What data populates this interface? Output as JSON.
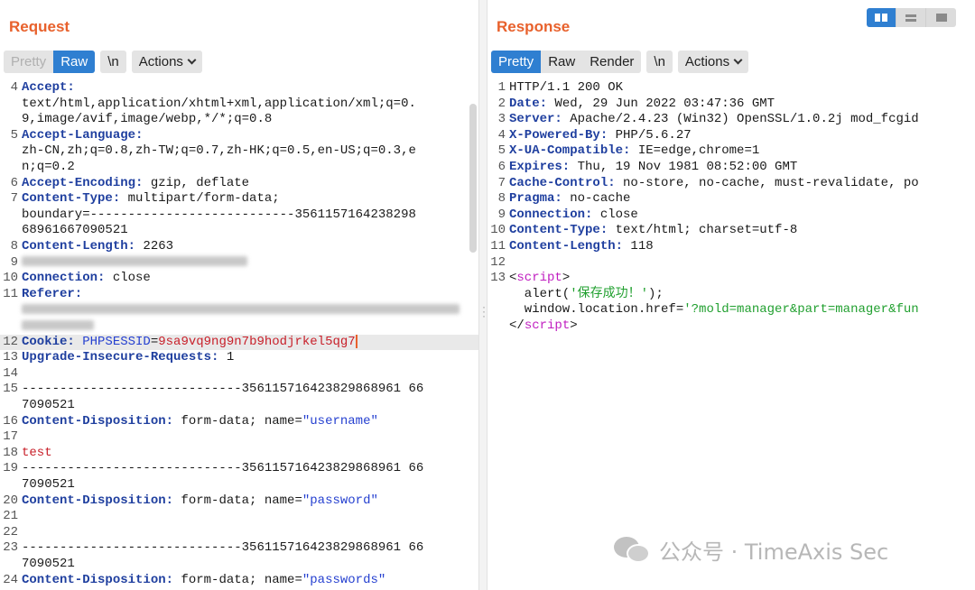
{
  "request": {
    "title": "Request",
    "tabs": [
      "Pretty",
      "Raw"
    ],
    "newline_label": "\\n",
    "actions_label": "Actions",
    "lines": [
      {
        "n": "4",
        "parts": [
          {
            "c": "hdr",
            "t": "Accept:"
          }
        ]
      },
      {
        "n": "",
        "parts": [
          {
            "t": "text/html,application/xhtml+xml,application/xml;q=0."
          }
        ]
      },
      {
        "n": "",
        "parts": [
          {
            "t": "9,image/avif,image/webp,*/*;q=0.8"
          }
        ]
      },
      {
        "n": "5",
        "parts": [
          {
            "c": "hdr",
            "t": "Accept-Language:"
          }
        ]
      },
      {
        "n": "",
        "parts": [
          {
            "t": "zh-CN,zh;q=0.8,zh-TW;q=0.7,zh-HK;q=0.5,en-US;q=0.3,e"
          }
        ]
      },
      {
        "n": "",
        "parts": [
          {
            "t": "n;q=0.2"
          }
        ]
      },
      {
        "n": "6",
        "parts": [
          {
            "c": "hdr",
            "t": "Accept-Encoding:"
          },
          {
            "t": " gzip, deflate"
          }
        ]
      },
      {
        "n": "7",
        "parts": [
          {
            "c": "hdr",
            "t": "Content-Type:"
          },
          {
            "t": " multipart/form-data;"
          }
        ]
      },
      {
        "n": "",
        "parts": [
          {
            "t": "boundary=---------------------------3561157164238298"
          }
        ]
      },
      {
        "n": "",
        "parts": [
          {
            "t": "68961667090521"
          }
        ]
      },
      {
        "n": "8",
        "parts": [
          {
            "c": "hdr",
            "t": "Content-Length:"
          },
          {
            "t": " 2263"
          }
        ]
      },
      {
        "n": "9",
        "parts": [
          {
            "c": "blur",
            "w": "250"
          }
        ]
      },
      {
        "n": "10",
        "parts": [
          {
            "c": "hdr",
            "t": "Connection:"
          },
          {
            "t": " close"
          }
        ]
      },
      {
        "n": "11",
        "parts": [
          {
            "c": "hdr",
            "t": "Referer:"
          }
        ]
      },
      {
        "n": "",
        "parts": [
          {
            "c": "blur",
            "w": "485"
          }
        ]
      },
      {
        "n": "",
        "parts": [
          {
            "c": "blur",
            "w": "80"
          }
        ]
      },
      {
        "n": "12",
        "hl": true,
        "parts": [
          {
            "c": "hdr",
            "t": "Cookie:"
          },
          {
            "t": " "
          },
          {
            "c": "str",
            "t": "PHPSESSID"
          },
          {
            "t": "="
          },
          {
            "c": "red",
            "t": "9sa9vq9ng9n7b9hodjrkel5qg7"
          },
          {
            "c": "cursor"
          }
        ]
      },
      {
        "n": "13",
        "parts": [
          {
            "c": "hdr",
            "t": "Upgrade-Insecure-Requests:"
          },
          {
            "t": " 1"
          }
        ]
      },
      {
        "n": "14",
        "parts": [
          {
            "t": ""
          }
        ]
      },
      {
        "n": "15",
        "parts": [
          {
            "t": "-----------------------------356115716423829868961 66"
          }
        ]
      },
      {
        "n": "",
        "parts": [
          {
            "t": "7090521"
          }
        ]
      },
      {
        "n": "16",
        "parts": [
          {
            "c": "hdr",
            "t": "Content-Disposition:"
          },
          {
            "t": " form-data; name="
          },
          {
            "c": "str",
            "t": "\"username\""
          }
        ]
      },
      {
        "n": "17",
        "parts": [
          {
            "t": ""
          }
        ]
      },
      {
        "n": "18",
        "parts": [
          {
            "c": "red",
            "t": "test"
          }
        ]
      },
      {
        "n": "19",
        "parts": [
          {
            "t": "-----------------------------356115716423829868961 66"
          }
        ]
      },
      {
        "n": "",
        "parts": [
          {
            "t": "7090521"
          }
        ]
      },
      {
        "n": "20",
        "parts": [
          {
            "c": "hdr",
            "t": "Content-Disposition:"
          },
          {
            "t": " form-data; name="
          },
          {
            "c": "str",
            "t": "\"password\""
          }
        ]
      },
      {
        "n": "21",
        "parts": [
          {
            "t": ""
          }
        ]
      },
      {
        "n": "22",
        "parts": [
          {
            "t": ""
          }
        ]
      },
      {
        "n": "23",
        "parts": [
          {
            "t": "-----------------------------356115716423829868961 66"
          }
        ]
      },
      {
        "n": "",
        "parts": [
          {
            "t": "7090521"
          }
        ]
      },
      {
        "n": "24",
        "parts": [
          {
            "c": "hdr",
            "t": "Content-Disposition:"
          },
          {
            "t": " form-data; name="
          },
          {
            "c": "str",
            "t": "\"passwords\""
          }
        ]
      }
    ]
  },
  "response": {
    "title": "Response",
    "tabs": [
      "Pretty",
      "Raw",
      "Render"
    ],
    "newline_label": "\\n",
    "actions_label": "Actions",
    "lines": [
      {
        "n": "1",
        "parts": [
          {
            "t": "HTTP/1.1 200 OK"
          }
        ]
      },
      {
        "n": "2",
        "parts": [
          {
            "c": "hdr",
            "t": "Date:"
          },
          {
            "t": " Wed, 29 Jun 2022 03:47:36 GMT"
          }
        ]
      },
      {
        "n": "3",
        "parts": [
          {
            "c": "hdr",
            "t": "Server:"
          },
          {
            "t": " Apache/2.4.23 (Win32) OpenSSL/1.0.2j mod_fcgid"
          }
        ]
      },
      {
        "n": "4",
        "parts": [
          {
            "c": "hdr",
            "t": "X-Powered-By:"
          },
          {
            "t": " PHP/5.6.27"
          }
        ]
      },
      {
        "n": "5",
        "parts": [
          {
            "c": "hdr",
            "t": "X-UA-Compatible:"
          },
          {
            "t": " IE=edge,chrome=1"
          }
        ]
      },
      {
        "n": "6",
        "parts": [
          {
            "c": "hdr",
            "t": "Expires:"
          },
          {
            "t": " Thu, 19 Nov 1981 08:52:00 GMT"
          }
        ]
      },
      {
        "n": "7",
        "parts": [
          {
            "c": "hdr",
            "t": "Cache-Control:"
          },
          {
            "t": " no-store, no-cache, must-revalidate, po"
          }
        ]
      },
      {
        "n": "8",
        "parts": [
          {
            "c": "hdr",
            "t": "Pragma:"
          },
          {
            "t": " no-cache"
          }
        ]
      },
      {
        "n": "9",
        "parts": [
          {
            "c": "hdr",
            "t": "Connection:"
          },
          {
            "t": " close"
          }
        ]
      },
      {
        "n": "10",
        "parts": [
          {
            "c": "hdr",
            "t": "Content-Type:"
          },
          {
            "t": " text/html; charset=utf-8"
          }
        ]
      },
      {
        "n": "11",
        "parts": [
          {
            "c": "hdr",
            "t": "Content-Length:"
          },
          {
            "t": " 118"
          }
        ]
      },
      {
        "n": "12",
        "parts": [
          {
            "t": ""
          }
        ]
      },
      {
        "n": "13",
        "parts": [
          {
            "t": "<"
          },
          {
            "c": "tag",
            "t": "script"
          },
          {
            "t": ">"
          }
        ]
      },
      {
        "n": "",
        "parts": [
          {
            "t": "  alert("
          },
          {
            "c": "grn",
            "t": "'保存成功！'"
          },
          {
            "t": ");"
          }
        ]
      },
      {
        "n": "",
        "parts": [
          {
            "t": "  window.location.href="
          },
          {
            "c": "grn",
            "t": "'?mold=manager&part=manager&fun"
          }
        ]
      },
      {
        "n": "",
        "parts": [
          {
            "t": "</"
          },
          {
            "c": "tag",
            "t": "script"
          },
          {
            "t": ">"
          }
        ]
      }
    ]
  },
  "view_switch": [
    "split-columns-icon",
    "split-rows-icon",
    "single-pane-icon"
  ],
  "watermark": {
    "text": "公众号 · TimeAxis Sec"
  },
  "colors": {
    "accent": "#e8612c",
    "active_tab": "#2f7fd1",
    "header_key": "#1f3f9f"
  }
}
